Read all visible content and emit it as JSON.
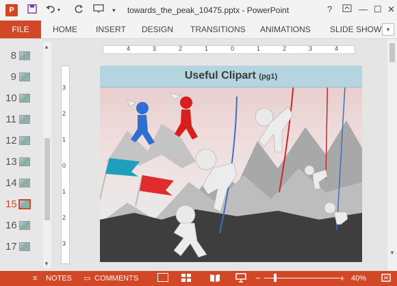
{
  "titlebar": {
    "logo": "P",
    "title": "towards_the_peak_10475.pptx - PowerPoint",
    "icons": [
      "save-icon",
      "undo-icon",
      "redo-icon",
      "present-icon",
      "customize-icon"
    ],
    "help": "?",
    "min": "—",
    "max": "☐",
    "close": "✕"
  },
  "ribbon": {
    "tabs": [
      "FILE",
      "HOME",
      "INSERT",
      "DESIGN",
      "TRANSITIONS",
      "ANIMATIONS",
      "SLIDE SHOW"
    ],
    "accent": "#d24726"
  },
  "thumbnails": [
    {
      "num": "8"
    },
    {
      "num": "9"
    },
    {
      "num": "10"
    },
    {
      "num": "11"
    },
    {
      "num": "12"
    },
    {
      "num": "13"
    },
    {
      "num": "14"
    },
    {
      "num": "15",
      "active": true
    },
    {
      "num": "16"
    },
    {
      "num": "17"
    }
  ],
  "ruler": {
    "h_labels": [
      "4",
      "3",
      "2",
      "1",
      "0",
      "1",
      "2",
      "3",
      "4"
    ],
    "v_labels": [
      "3",
      "2",
      "1",
      "0",
      "1",
      "2",
      "3"
    ]
  },
  "slide": {
    "title": "Useful Clipart",
    "subtitle": "(pg1)"
  },
  "statusbar": {
    "notes": "NOTES",
    "comments": "COMMENTS",
    "zoom": "40%",
    "zoom_minus": "−",
    "zoom_plus": "+"
  }
}
